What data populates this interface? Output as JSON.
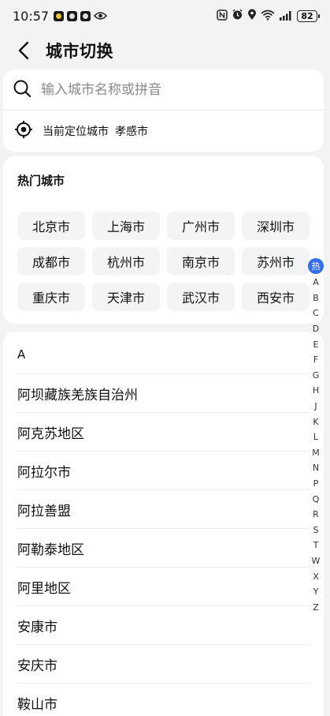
{
  "status_bar": {
    "time": "10:57",
    "battery": "82",
    "icons": [
      "app-icon-1",
      "app-icon-2",
      "app-icon-3",
      "eye-icon",
      "nfc-icon",
      "alarm-icon",
      "location-icon",
      "wifi-icon",
      "signal-icon"
    ]
  },
  "nav": {
    "title": "城市切换"
  },
  "search": {
    "placeholder": "输入城市名称或拼音"
  },
  "location": {
    "label": "当前定位城市",
    "city": "孝感市"
  },
  "hot": {
    "title": "热门城市",
    "cities": [
      "北京市",
      "上海市",
      "广州市",
      "深圳市",
      "成都市",
      "杭州市",
      "南京市",
      "苏州市",
      "重庆市",
      "天津市",
      "武汉市",
      "西安市"
    ]
  },
  "list": {
    "section": "A",
    "cities": [
      "阿坝藏族羌族自治州",
      "阿克苏地区",
      "阿拉尔市",
      "阿拉善盟",
      "阿勒泰地区",
      "阿里地区",
      "安康市",
      "安庆市",
      "鞍山市"
    ]
  },
  "index_bar": {
    "hot": "热",
    "letters": [
      "A",
      "B",
      "C",
      "D",
      "E",
      "F",
      "G",
      "H",
      "J",
      "K",
      "L",
      "M",
      "N",
      "P",
      "Q",
      "R",
      "S",
      "T",
      "W",
      "X",
      "Y",
      "Z"
    ]
  },
  "colors": {
    "accent": "#2f6ef6",
    "background": "#f2f3f5"
  }
}
